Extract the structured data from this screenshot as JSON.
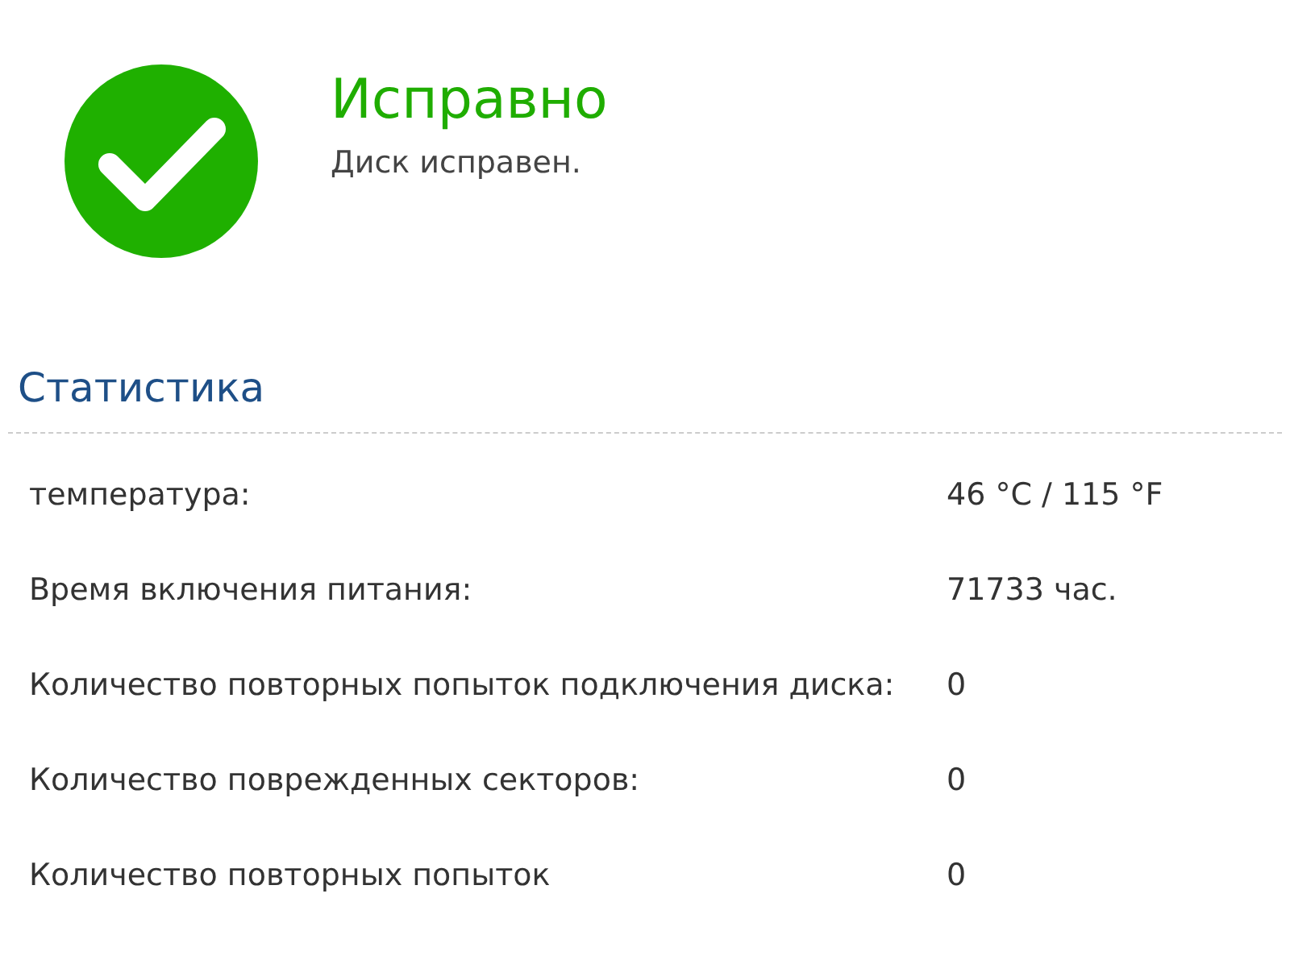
{
  "status": {
    "title": "Исправно",
    "message": "Диск исправен.",
    "healthy": true
  },
  "statistics": {
    "heading": "Статистика",
    "rows": [
      {
        "label": "температура:",
        "value": "46 °C / 115 °F"
      },
      {
        "label": "Время включения питания:",
        "value": "71733 час."
      },
      {
        "label": "Количество повторных попыток подключения диска:",
        "value": "0"
      },
      {
        "label": "Количество поврежденных секторов:",
        "value": "0"
      },
      {
        "label": "Количество повторных попыток",
        "value": "0"
      }
    ]
  }
}
